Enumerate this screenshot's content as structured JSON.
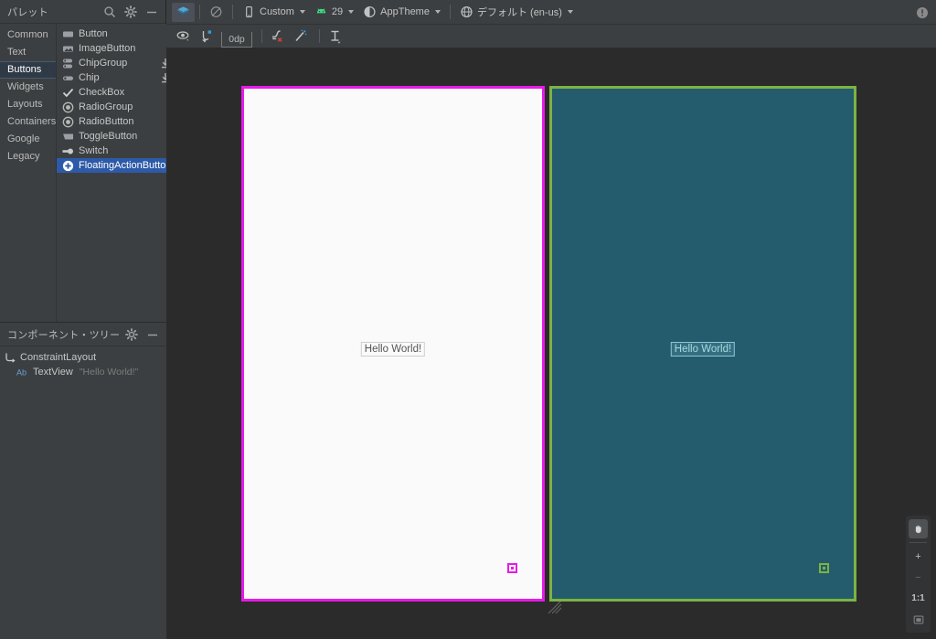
{
  "palette": {
    "title": "パレット",
    "icons": {
      "search": "search-icon",
      "gear": "gear-icon",
      "minimize": "minimize-icon"
    },
    "categories": [
      {
        "label": "Common",
        "selected": false
      },
      {
        "label": "Text",
        "selected": false
      },
      {
        "label": "Buttons",
        "selected": true
      },
      {
        "label": "Widgets",
        "selected": false
      },
      {
        "label": "Layouts",
        "selected": false
      },
      {
        "label": "Containers",
        "selected": false
      },
      {
        "label": "Google",
        "selected": false
      },
      {
        "label": "Legacy",
        "selected": false
      }
    ],
    "items": [
      {
        "label": "Button",
        "icon": "button-icon",
        "selected": false,
        "download": false
      },
      {
        "label": "ImageButton",
        "icon": "image-button-icon",
        "selected": false,
        "download": false
      },
      {
        "label": "ChipGroup",
        "icon": "chip-group-icon",
        "selected": false,
        "download": true
      },
      {
        "label": "Chip",
        "icon": "chip-icon",
        "selected": false,
        "download": true
      },
      {
        "label": "CheckBox",
        "icon": "checkbox-icon",
        "selected": false,
        "download": false
      },
      {
        "label": "RadioGroup",
        "icon": "radio-group-icon",
        "selected": false,
        "download": false
      },
      {
        "label": "RadioButton",
        "icon": "radio-button-icon",
        "selected": false,
        "download": false
      },
      {
        "label": "ToggleButton",
        "icon": "toggle-button-icon",
        "selected": false,
        "download": false
      },
      {
        "label": "Switch",
        "icon": "switch-icon",
        "selected": false,
        "download": false
      },
      {
        "label": "FloatingActionButton",
        "icon": "floating-action-button-icon",
        "selected": true,
        "download": false
      }
    ]
  },
  "component_tree": {
    "title": "コンポーネント・ツリー",
    "nodes": [
      {
        "label": "ConstraintLayout",
        "sub": "",
        "icon": "constraint-layout-icon",
        "indent": false
      },
      {
        "label": "TextView",
        "sub": "\"Hello World!\"",
        "icon": "ab-text-icon",
        "indent": true
      }
    ]
  },
  "toolbar": {
    "design_mode_label": "",
    "device_label": "Custom",
    "api_label": "29",
    "theme_label": "AppTheme",
    "locale_label": "デフォルト (en-us)",
    "info_tooltip": "info-icon",
    "margin_value": "0dp"
  },
  "surface": {
    "devices": [
      {
        "name": "preview-light",
        "text": "Hello World!",
        "border_color": "#e819e8",
        "background": "#fafafa",
        "text_color": "#555555"
      },
      {
        "name": "preview-dark",
        "text": "Hello World!",
        "border_color": "#7cb342",
        "background": "#245c6e",
        "text_color": "#a8d8e0"
      }
    ]
  },
  "zoom_controls": {
    "pan_label": "pan-hand-icon",
    "zoom_in_label": "+",
    "zoom_out_label": "−",
    "zoom_actual_label": "1:1",
    "zoom_fit_label": "zoom-to-fit-icon"
  },
  "colors": {
    "panel_bg": "#3c3f41",
    "surface_bg": "#2b2b2b",
    "accent_selected": "#2d5aa8",
    "magenta": "#e819e8",
    "green": "#7cb342",
    "teal": "#245c6e"
  }
}
